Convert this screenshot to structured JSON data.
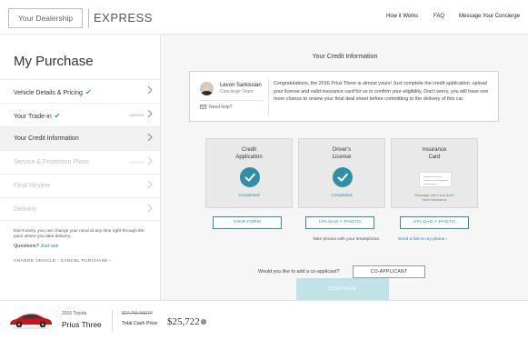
{
  "header": {
    "dealership_label": "Your Dealership",
    "product_label": "EXPRESS",
    "nav": [
      {
        "label": "How it Works"
      },
      {
        "label": "FAQ"
      },
      {
        "label": "Message Your Concierge"
      }
    ]
  },
  "sidebar": {
    "title": "My Purchase",
    "items": [
      {
        "label": "Vehicle Details & Pricing",
        "completed": true,
        "optional": "",
        "state": "done"
      },
      {
        "label": "Your Trade-in",
        "completed": true,
        "optional": "optional",
        "state": "done"
      },
      {
        "label": "Your Credit Information",
        "completed": false,
        "optional": "",
        "state": "active"
      },
      {
        "label": "Service & Protection Plans",
        "completed": false,
        "optional": "optional",
        "state": "disabled"
      },
      {
        "label": "Final Review",
        "completed": false,
        "optional": "",
        "state": "disabled"
      },
      {
        "label": "Delivery",
        "completed": false,
        "optional": "",
        "state": "disabled"
      }
    ],
    "note": "Don't worry, you can change your mind at any time right through the point where you take delivery.",
    "questions_label": "Questions?",
    "questions_link": "Just ask",
    "change_vehicle_link": "CHANGE VEHICLE",
    "separator": "›",
    "cancel_purchase_link": "CANCEL PURCHASE",
    "cancel_suffix": "›"
  },
  "main": {
    "title": "Your Credit Information",
    "concierge": {
      "name": "Levon Sarkissian",
      "team": "Concierge Team",
      "help_label": "Need help?",
      "message": "Congratulations, the 2016 Prius Three is almost yours! Just complete the credit application, upload your license and valid insurance card for us to confirm your eligibility. Don't worry, you will have one more chance to review your final deal sheet before committing to the delivery of this car."
    },
    "cards": [
      {
        "title_line1": "Credit",
        "title_line2": "Application",
        "status": "Completed",
        "button": "VIEW FORM"
      },
      {
        "title_line1": "Driver's",
        "title_line2": "License",
        "status": "Completed",
        "button": "UPLOAD A PHOTO"
      },
      {
        "title_line1": "Insurance",
        "title_line2": "Card",
        "status_line1": "Message me if you don't",
        "status_line2": "have insurance",
        "button": "UPLOAD A PHOTO"
      }
    ],
    "photo_note": "Take photos with your smartphone.",
    "photo_link": "Send a link to my phone ›",
    "coapplicant_question": "Would you like to add a co-applicant?",
    "coapplicant_button": "CO-APPLICANT",
    "continue_button": "CONTINUE",
    "accent_color": "#2e8fa6"
  },
  "footer": {
    "year_make": "2016 Toyota",
    "model": "Prius Three",
    "msrp": "$27,765 MSRP",
    "total_label": "Total Cash Price",
    "total_value": "$25,722",
    "car_color": "#c4161c"
  }
}
